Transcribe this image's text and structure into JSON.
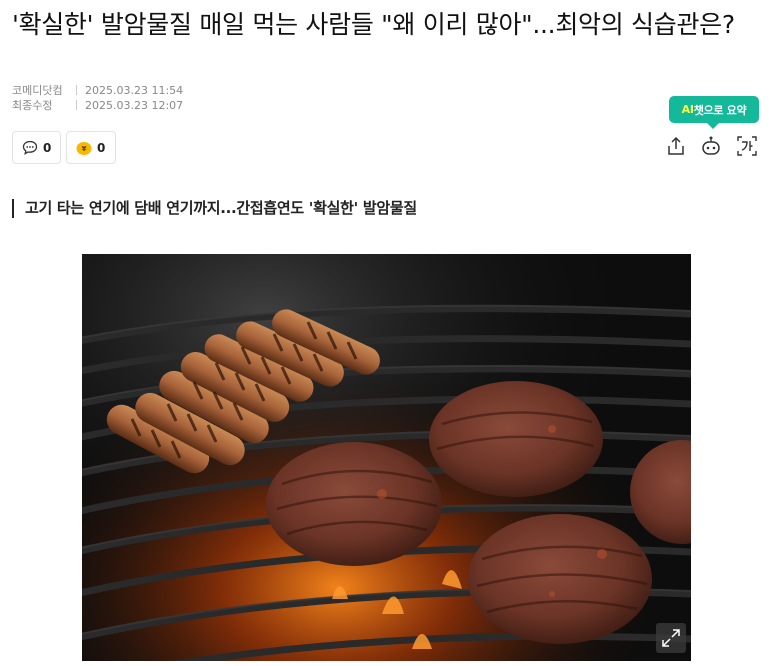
{
  "article": {
    "headline": "'확실한' 발암물질 매일 먹는 사람들 \"왜 이리 많아\"...최악의 식습관은?",
    "meta": {
      "published_label": "코메디닷컴",
      "published_date": "2025.03.23 11:54",
      "modified_label": "최종수정",
      "modified_date": "2025.03.23 12:07"
    },
    "reactions": {
      "comment_count": "0",
      "reward_count": "0"
    },
    "ai_summary_badge": {
      "ai": "AI",
      "rest": "챗으로 요약"
    },
    "subheading": "고기 타는 연기에 담배 연기까지...간접흡연도 '확실한' 발암물질"
  },
  "icons": {
    "comment": "comment-icon",
    "reward": "reward-icon",
    "share": "share-icon",
    "ai_bot": "ai-bot-icon",
    "font": "font-size-icon",
    "expand": "expand-icon"
  },
  "colors": {
    "accent": "#13b999",
    "ai_highlight": "#f7ff4a",
    "reward_yellow": "#f6b800"
  }
}
